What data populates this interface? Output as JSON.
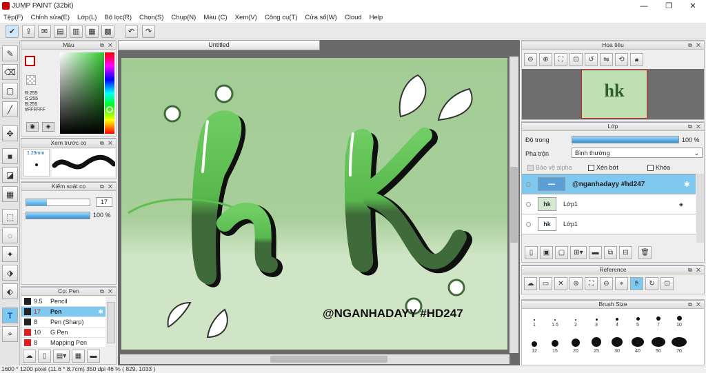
{
  "window": {
    "title": "JUMP PAINT (32bit)",
    "min": "—",
    "restore": "❐",
    "close": "✕"
  },
  "menu": [
    "Tệp(F)",
    "Chỉnh sửa(E)",
    "Lớp(L)",
    "Bộ lọc(R)",
    "Chọn(S)",
    "Chụp(N)",
    "Màu (C)",
    "Xem(V)",
    "Công cụ(T)",
    "Cửa sổ(W)",
    "Cloud",
    "Help"
  ],
  "color_panel": {
    "title": "Màu",
    "r": "R:255",
    "g": "G:255",
    "b": "B:255",
    "hex": "#FFFFFF"
  },
  "preview_panel": {
    "title": "Xem trước cọ",
    "size": "1.29mm"
  },
  "control_panel": {
    "title": "Kiểm soát cọ",
    "size_value": "17",
    "opacity_value": "100 %"
  },
  "brush_panel": {
    "title": "Cọ: Pen",
    "items": [
      {
        "size": "9.5",
        "name": "Pencil",
        "color": "#222222"
      },
      {
        "size": "17",
        "name": "Pen",
        "color": "#222222"
      },
      {
        "size": "8",
        "name": "Pen (Sharp)",
        "color": "#222222"
      },
      {
        "size": "10",
        "name": "G Pen",
        "color": "#e02020"
      },
      {
        "size": "8",
        "name": "Mapping Pen",
        "color": "#e02020"
      }
    ]
  },
  "document": {
    "tab": "Untitled",
    "caption": "@NGANHADAYY #HD247"
  },
  "navigator": {
    "title": "Hoa tiêu"
  },
  "layers": {
    "title": "Lớp",
    "opacity_label": "Độ trong",
    "opacity_value": "100 %",
    "blend_label": "Pha trộn",
    "blend_value": "Bình thường",
    "protect_alpha": "Bảo vệ alpha",
    "clip": "Xén bớt",
    "lock": "Khóa",
    "items": [
      {
        "name": "@nganhadayy #hd247"
      },
      {
        "name": "Lớp1"
      },
      {
        "name": "Lớp1"
      }
    ]
  },
  "reference": {
    "title": "Reference"
  },
  "brush_size": {
    "title": "Brush Size",
    "sizes": [
      "1",
      "1.5",
      "2",
      "3",
      "4",
      "5",
      "7",
      "10",
      "12",
      "15",
      "20",
      "25",
      "30",
      "40",
      "50",
      "70"
    ]
  },
  "status": "1600 * 1200 pixel   (11.6 * 8.7cm)   350 dpi   46 %   ( 829, 1033 )",
  "colors": {
    "canvas_bg": "#a3cc95",
    "accent": "#0b84d8",
    "highlight": "#7fc8f0"
  }
}
